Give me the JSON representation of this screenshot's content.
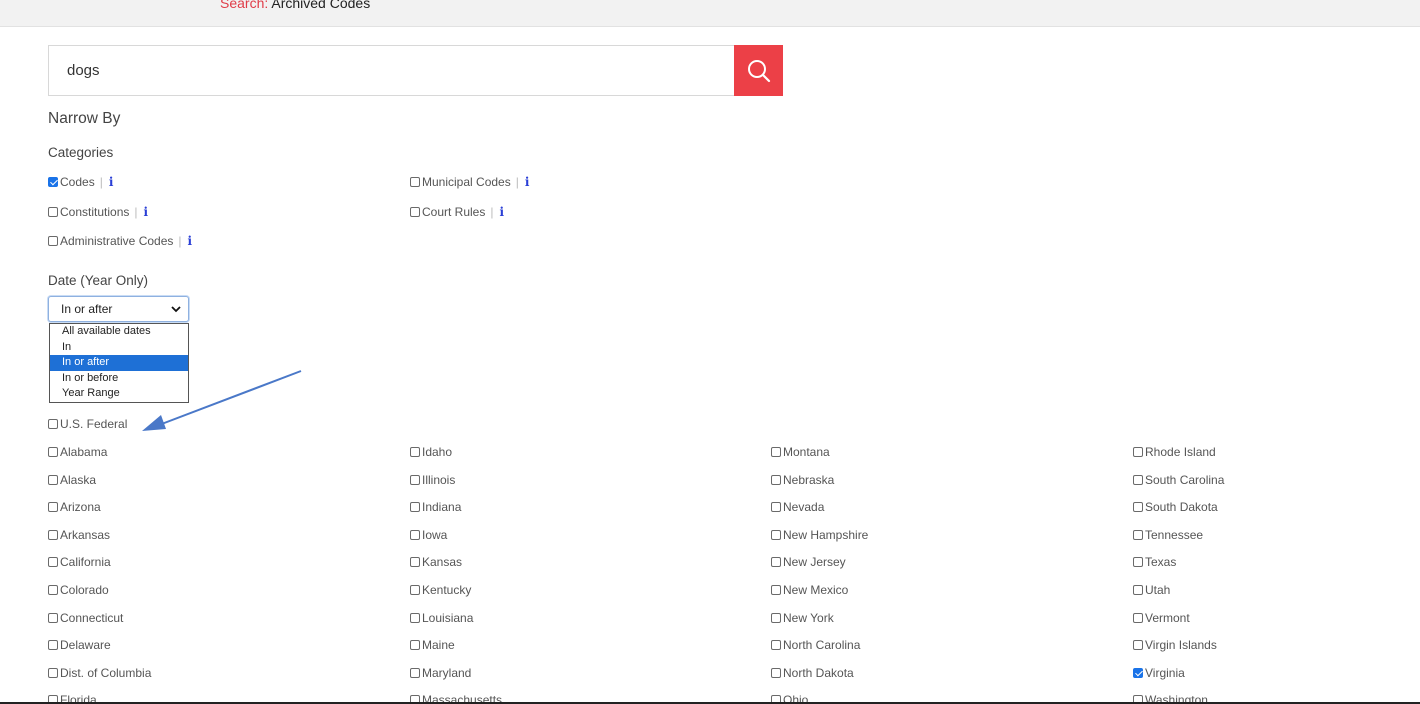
{
  "breadcrumb": {
    "label": "Search:",
    "value": "Archived Codes"
  },
  "search": {
    "value": "dogs",
    "button_icon": "search-icon"
  },
  "narrow_by": "Narrow By",
  "categories": {
    "heading": "Categories",
    "info_label": "i",
    "items": [
      {
        "label": "Codes",
        "checked": true
      },
      {
        "label": "Constitutions",
        "checked": false
      },
      {
        "label": "Administrative Codes",
        "checked": false
      },
      {
        "label": "Municipal Codes",
        "checked": false
      },
      {
        "label": "Court Rules",
        "checked": false
      }
    ]
  },
  "date": {
    "heading": "Date (Year Only)",
    "selected": "In or after",
    "options": [
      "All available dates",
      "In",
      "In or after",
      "In or before",
      "Year Range"
    ]
  },
  "federal": {
    "label": "U.S. Federal",
    "checked": false
  },
  "states": [
    [
      {
        "label": "Alabama",
        "checked": false
      },
      {
        "label": "Alaska",
        "checked": false
      },
      {
        "label": "Arizona",
        "checked": false
      },
      {
        "label": "Arkansas",
        "checked": false
      },
      {
        "label": "California",
        "checked": false
      },
      {
        "label": "Colorado",
        "checked": false
      },
      {
        "label": "Connecticut",
        "checked": false
      },
      {
        "label": "Delaware",
        "checked": false
      },
      {
        "label": "Dist. of Columbia",
        "checked": false
      },
      {
        "label": "Florida",
        "checked": false
      }
    ],
    [
      {
        "label": "Idaho",
        "checked": false
      },
      {
        "label": "Illinois",
        "checked": false
      },
      {
        "label": "Indiana",
        "checked": false
      },
      {
        "label": "Iowa",
        "checked": false
      },
      {
        "label": "Kansas",
        "checked": false
      },
      {
        "label": "Kentucky",
        "checked": false
      },
      {
        "label": "Louisiana",
        "checked": false
      },
      {
        "label": "Maine",
        "checked": false
      },
      {
        "label": "Maryland",
        "checked": false
      },
      {
        "label": "Massachusetts",
        "checked": false
      }
    ],
    [
      {
        "label": "Montana",
        "checked": false
      },
      {
        "label": "Nebraska",
        "checked": false
      },
      {
        "label": "Nevada",
        "checked": false
      },
      {
        "label": "New Hampshire",
        "checked": false
      },
      {
        "label": "New Jersey",
        "checked": false
      },
      {
        "label": "New Mexico",
        "checked": false
      },
      {
        "label": "New York",
        "checked": false
      },
      {
        "label": "North Carolina",
        "checked": false
      },
      {
        "label": "North Dakota",
        "checked": false
      },
      {
        "label": "Ohio",
        "checked": false
      }
    ],
    [
      {
        "label": "Rhode Island",
        "checked": false
      },
      {
        "label": "South Carolina",
        "checked": false
      },
      {
        "label": "South Dakota",
        "checked": false
      },
      {
        "label": "Tennessee",
        "checked": false
      },
      {
        "label": "Texas",
        "checked": false
      },
      {
        "label": "Utah",
        "checked": false
      },
      {
        "label": "Vermont",
        "checked": false
      },
      {
        "label": "Virgin Islands",
        "checked": false
      },
      {
        "label": "Virginia",
        "checked": true
      },
      {
        "label": "Washington",
        "checked": false
      }
    ]
  ],
  "colors": {
    "accent": "#ec4047",
    "breadcrumb_label": "#e03c48",
    "info_icon": "#2a3fd6",
    "arrow": "#4a78c8",
    "selected_option": "#1e70d6"
  }
}
